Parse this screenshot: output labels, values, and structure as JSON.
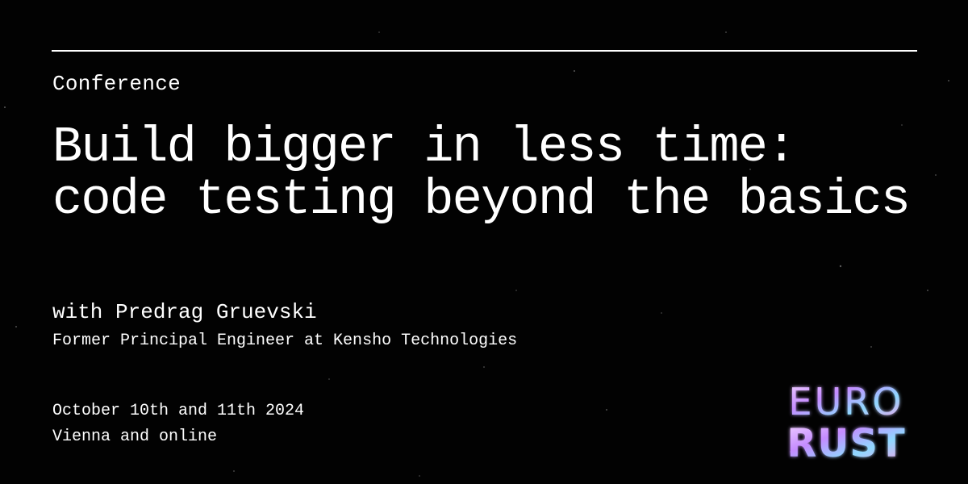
{
  "event": {
    "category": "Conference",
    "title": "Build bigger in less time: code testing beyond the basics",
    "speaker_line": "with Predrag Gruevski",
    "speaker_role": "Former Principal Engineer at Kensho Technologies",
    "date": "October 10th and 11th 2024",
    "location": "Vienna and online"
  },
  "logo": {
    "line1": "EURO",
    "line2": "RUST"
  },
  "colors": {
    "background": "#020202",
    "text": "#ffffff",
    "logo_gradient": [
      "#f3d4ff",
      "#c48bff",
      "#8fd8ff",
      "#ff9de6"
    ]
  }
}
